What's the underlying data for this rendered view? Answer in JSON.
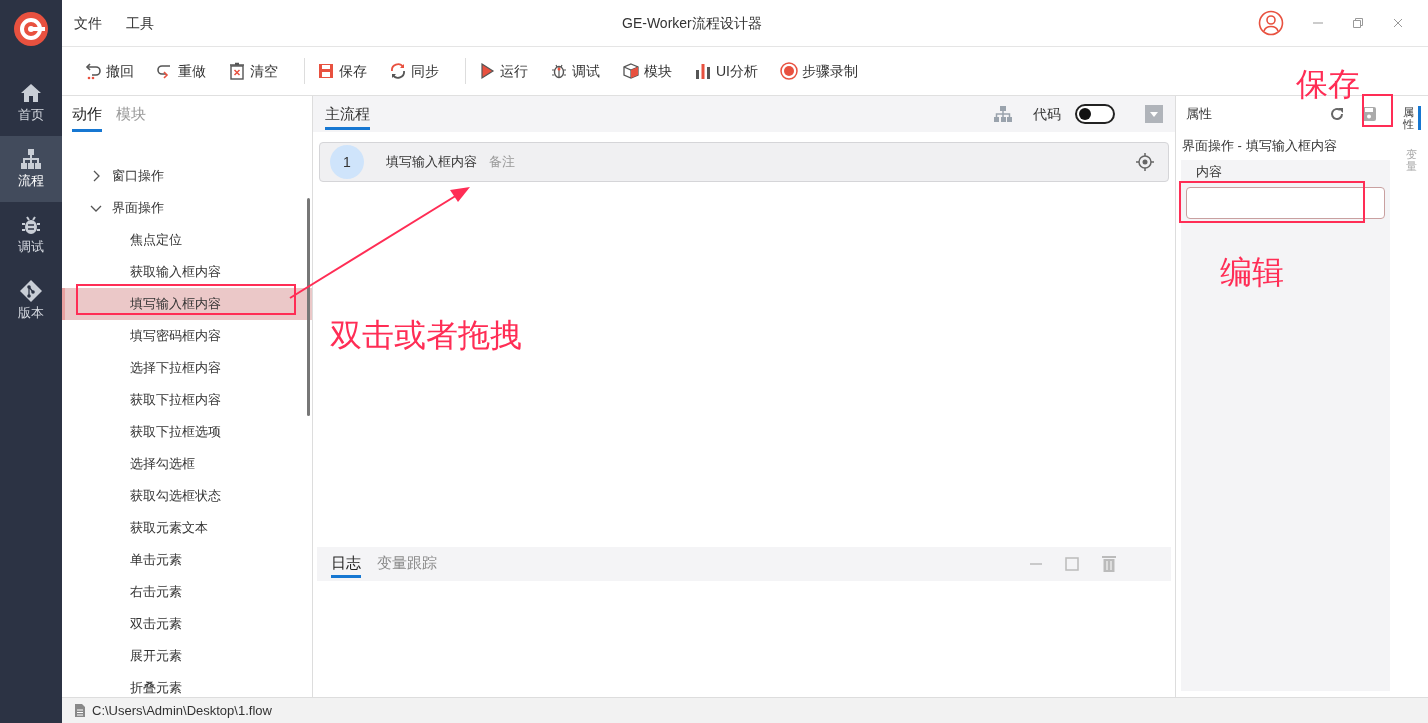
{
  "window": {
    "title": "GE-Worker流程设计器"
  },
  "menu": [
    "文件",
    "工具"
  ],
  "toolbar": [
    {
      "label": "撤回"
    },
    {
      "label": "重做"
    },
    {
      "label": "清空"
    },
    {
      "label": "保存"
    },
    {
      "label": "同步"
    },
    {
      "label": "运行"
    },
    {
      "label": "调试"
    },
    {
      "label": "模块"
    },
    {
      "label": "UI分析"
    },
    {
      "label": "步骤录制"
    }
  ],
  "nav": [
    {
      "label": "首页",
      "selected": false
    },
    {
      "label": "流程",
      "selected": true
    },
    {
      "label": "调试",
      "selected": false
    },
    {
      "label": "版本",
      "selected": false
    }
  ],
  "left_tabs": [
    {
      "label": "动作",
      "selected": true
    },
    {
      "label": "模块",
      "selected": false
    }
  ],
  "tree": [
    {
      "label": "窗口操作",
      "expanded": false,
      "selected": false
    },
    {
      "label": "界面操作",
      "expanded": true,
      "selected": false,
      "children": [
        {
          "label": "焦点定位",
          "selected": false
        },
        {
          "label": "获取输入框内容",
          "selected": false
        },
        {
          "label": "填写输入框内容",
          "selected": true
        },
        {
          "label": "填写密码框内容",
          "selected": false
        },
        {
          "label": "选择下拉框内容",
          "selected": false
        },
        {
          "label": "获取下拉框内容",
          "selected": false
        },
        {
          "label": "获取下拉框选项",
          "selected": false
        },
        {
          "label": "选择勾选框",
          "selected": false
        },
        {
          "label": "获取勾选框状态",
          "selected": false
        },
        {
          "label": "获取元素文本",
          "selected": false
        },
        {
          "label": "单击元素",
          "selected": false
        },
        {
          "label": "右击元素",
          "selected": false
        },
        {
          "label": "双击元素",
          "selected": false
        },
        {
          "label": "展开元素",
          "selected": false
        },
        {
          "label": "折叠元素",
          "selected": false
        }
      ]
    }
  ],
  "flow": {
    "tab": "主流程",
    "code_label": "代码",
    "code_on": false,
    "steps": [
      {
        "number": "1",
        "name": "填写输入框内容",
        "note": "备注"
      }
    ]
  },
  "log": {
    "tabs": [
      {
        "label": "日志",
        "selected": true
      },
      {
        "label": "变量跟踪",
        "selected": false
      }
    ]
  },
  "properties": {
    "title": "属性",
    "subtitle": "界面操作 - 填写输入框内容",
    "field_label": "内容"
  },
  "side_tabs": [
    {
      "label": "属性",
      "selected": true
    },
    {
      "label": "变量",
      "selected": false
    }
  ],
  "status_bar": "C:\\Users\\Admin\\Desktop\\1.flow",
  "annotations": [
    {
      "text": "双击或者拖拽"
    },
    {
      "text": "保存"
    },
    {
      "text": "编辑"
    }
  ]
}
